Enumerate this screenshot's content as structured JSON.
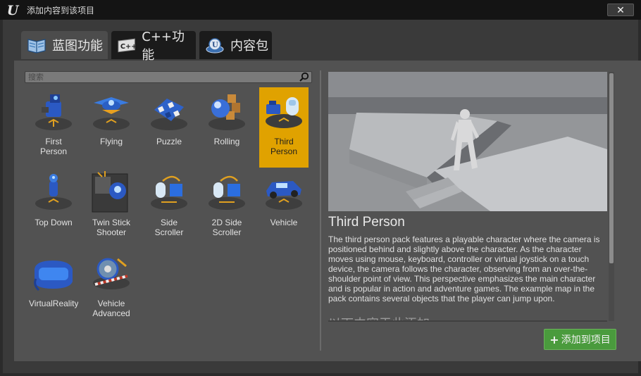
{
  "window": {
    "title": "添加内容到该项目",
    "close_label": "✕"
  },
  "tabs": [
    {
      "label": "蓝图功能",
      "icon": "blueprint-book-icon",
      "active": true
    },
    {
      "label": "C++功能",
      "icon": "cpp-icon",
      "active": false
    },
    {
      "label": "内容包",
      "icon": "content-pack-icon",
      "active": false
    }
  ],
  "search": {
    "placeholder": "搜索",
    "value": ""
  },
  "items": [
    {
      "label": "First\nPerson",
      "icon": "first-person-icon",
      "selected": false
    },
    {
      "label": "Flying",
      "icon": "flying-icon",
      "selected": false
    },
    {
      "label": "Puzzle",
      "icon": "puzzle-icon",
      "selected": false
    },
    {
      "label": "Rolling",
      "icon": "rolling-icon",
      "selected": false
    },
    {
      "label": "Third\nPerson",
      "icon": "third-person-icon",
      "selected": true
    },
    {
      "label": "Top Down",
      "icon": "top-down-icon",
      "selected": false
    },
    {
      "label": "Twin Stick\nShooter",
      "icon": "twin-stick-shooter-icon",
      "selected": false
    },
    {
      "label": "Side\nScroller",
      "icon": "side-scroller-icon",
      "selected": false
    },
    {
      "label": "2D Side\nScroller",
      "icon": "2d-side-scroller-icon",
      "selected": false
    },
    {
      "label": "Vehicle",
      "icon": "vehicle-icon",
      "selected": false
    },
    {
      "label": "VirtualReality",
      "icon": "virtual-reality-icon",
      "selected": false
    },
    {
      "label": "Vehicle\nAdvanced",
      "icon": "vehicle-advanced-icon",
      "selected": false
    }
  ],
  "detail": {
    "title": "Third Person",
    "description": "The third person pack features a playable character where the camera is positioned behind and slightly above the character. As the character moves using mouse, keyboard, controller or virtual joystick on a touch device, the camera follows the character, observing from an over-the-shoulder point of view. This perspective emphasizes the main character and is popular in action and adventure games. The example map in the pack contains several objects that the player can jump upon.",
    "more_text": "以下内容于此添加"
  },
  "add_button": {
    "label": "添加到项目",
    "icon": "plus-icon"
  },
  "colors": {
    "selected": "#e0a200",
    "add_button": "#4a9b3d",
    "panel": "#525252"
  }
}
